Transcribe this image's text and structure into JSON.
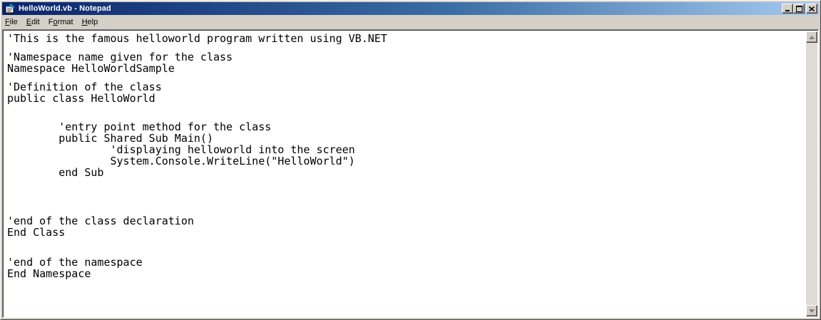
{
  "window": {
    "title": "HelloWorld.vb - Notepad",
    "app_icon": "notepad-icon",
    "controls": {
      "minimize_icon": "minimize-icon",
      "maximize_icon": "maximize-icon",
      "close_icon": "close-icon"
    }
  },
  "menu": [
    {
      "mnemonic": "F",
      "rest": "ile"
    },
    {
      "mnemonic": "E",
      "rest": "dit"
    },
    {
      "pre": "F",
      "mnemonic": "o",
      "rest": "rmat"
    },
    {
      "mnemonic": "H",
      "rest": "elp"
    }
  ],
  "editor": {
    "lines": [
      "'This is the famous helloworld program written using VB.NET",
      "'Namespace name given for the class",
      "Namespace HelloWorldSample",
      "'Definition of the class",
      "public class HelloWorld",
      "        'entry point method for the class",
      "        public Shared Sub Main()",
      "                'displaying helloworld into the screen",
      "                System.Console.WriteLine(\"HelloWorld\")",
      "        end Sub",
      "'end of the class declaration",
      "End Class",
      "'end of the namespace",
      "End Namespace"
    ]
  },
  "scrollbar": {
    "up_icon": "scroll-up-arrow-icon",
    "down_icon": "scroll-down-arrow-icon"
  },
  "colors": {
    "titlebar_start": "#0a246a",
    "titlebar_end": "#a6caf0",
    "chrome": "#d4d0c8",
    "editor_bg": "#ffffff"
  }
}
